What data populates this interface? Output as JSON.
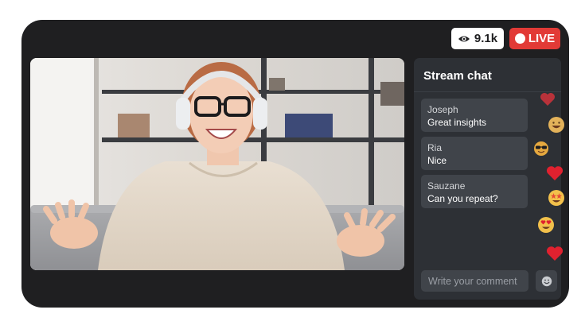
{
  "stream": {
    "viewers_label": "9.1k",
    "live_label": "LIVE"
  },
  "chat": {
    "title": "Stream chat",
    "messages": [
      {
        "author": "Joseph",
        "text": "Great insights"
      },
      {
        "author": "Ria",
        "text": "Nice"
      },
      {
        "author": "Sauzane",
        "text": "Can you repeat?"
      }
    ],
    "comment_placeholder": "Write your comment"
  },
  "reactions": [
    "heart-icon",
    "grinning-face-icon",
    "sunglasses-face-icon",
    "heart-icon",
    "star-struck-face-icon",
    "heart-eyes-face-icon",
    "heart-icon"
  ],
  "colors": {
    "frame": "#1f1f21",
    "live_red": "#e23a36",
    "chat_panel": "#2d3035",
    "message_bubble": "#40444a"
  }
}
